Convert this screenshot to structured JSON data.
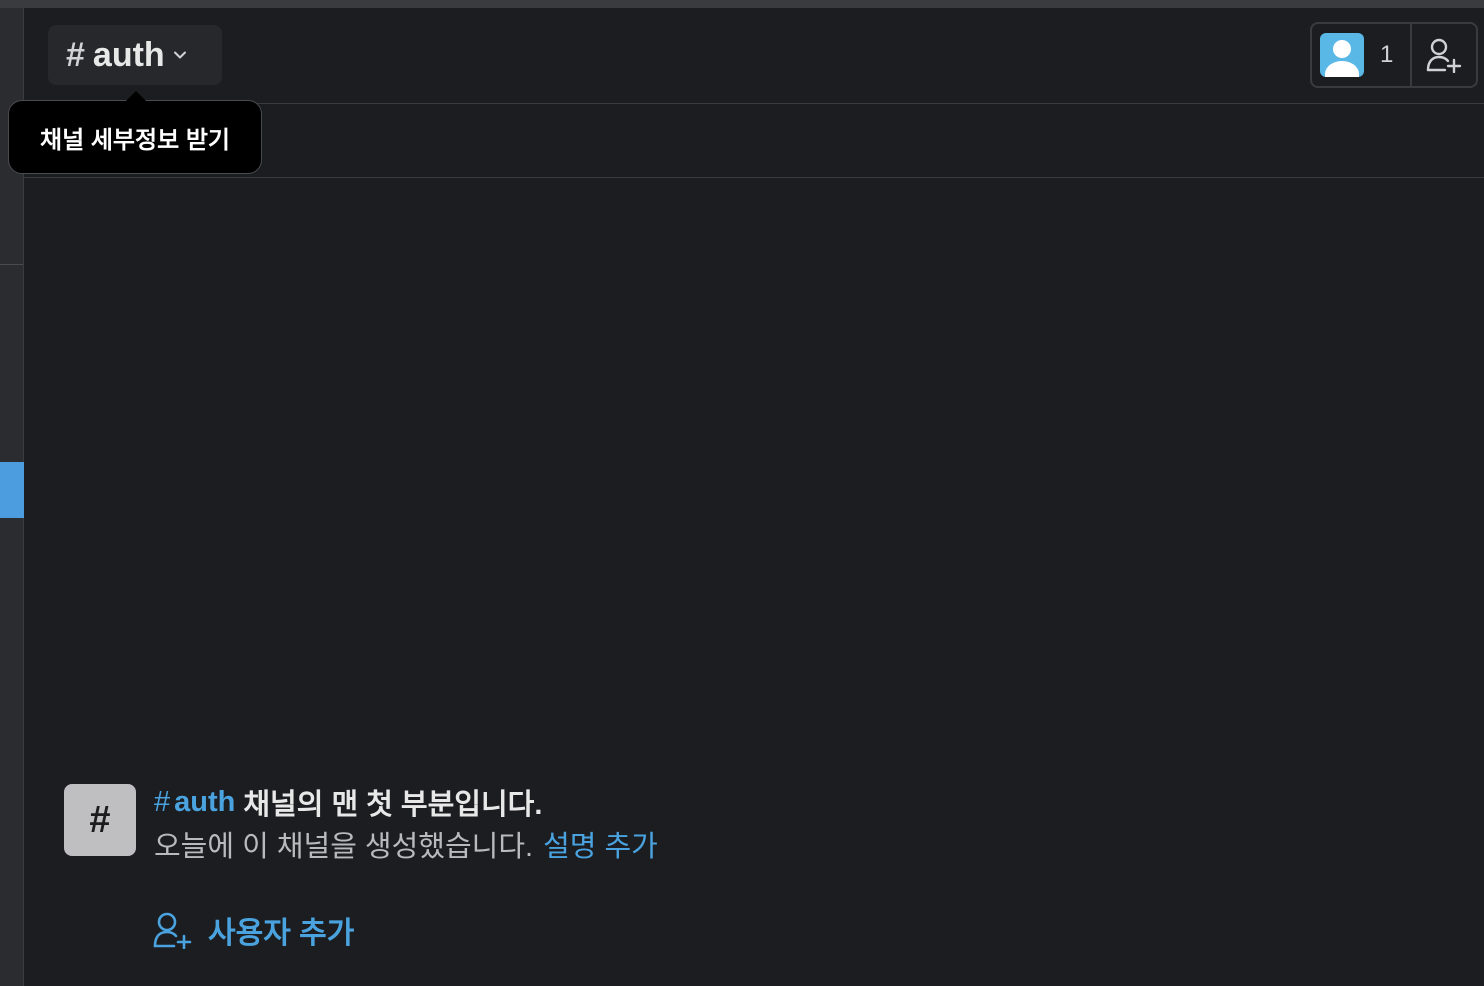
{
  "header": {
    "channel_hash": "#",
    "channel_name": "auth",
    "member_count": "1"
  },
  "tooltip": {
    "text": "채널 세부정보 받기"
  },
  "intro": {
    "icon_glyph": "#",
    "channel_hash": "#",
    "channel_name": "auth",
    "headline_rest": "채널의 맨 첫 부분입니다.",
    "created_text": "오늘에 이 채널을 생성했습니다.",
    "add_description_link": "설명 추가",
    "add_user_label": "사용자 추가"
  },
  "colors": {
    "background": "#1b1d21",
    "accent_link": "#4aa3df",
    "avatar": "#5ab8e6",
    "active_marker": "#4c9de0"
  },
  "icons": [
    "chevron-down-icon",
    "avatar-icon",
    "add-user-icon"
  ]
}
